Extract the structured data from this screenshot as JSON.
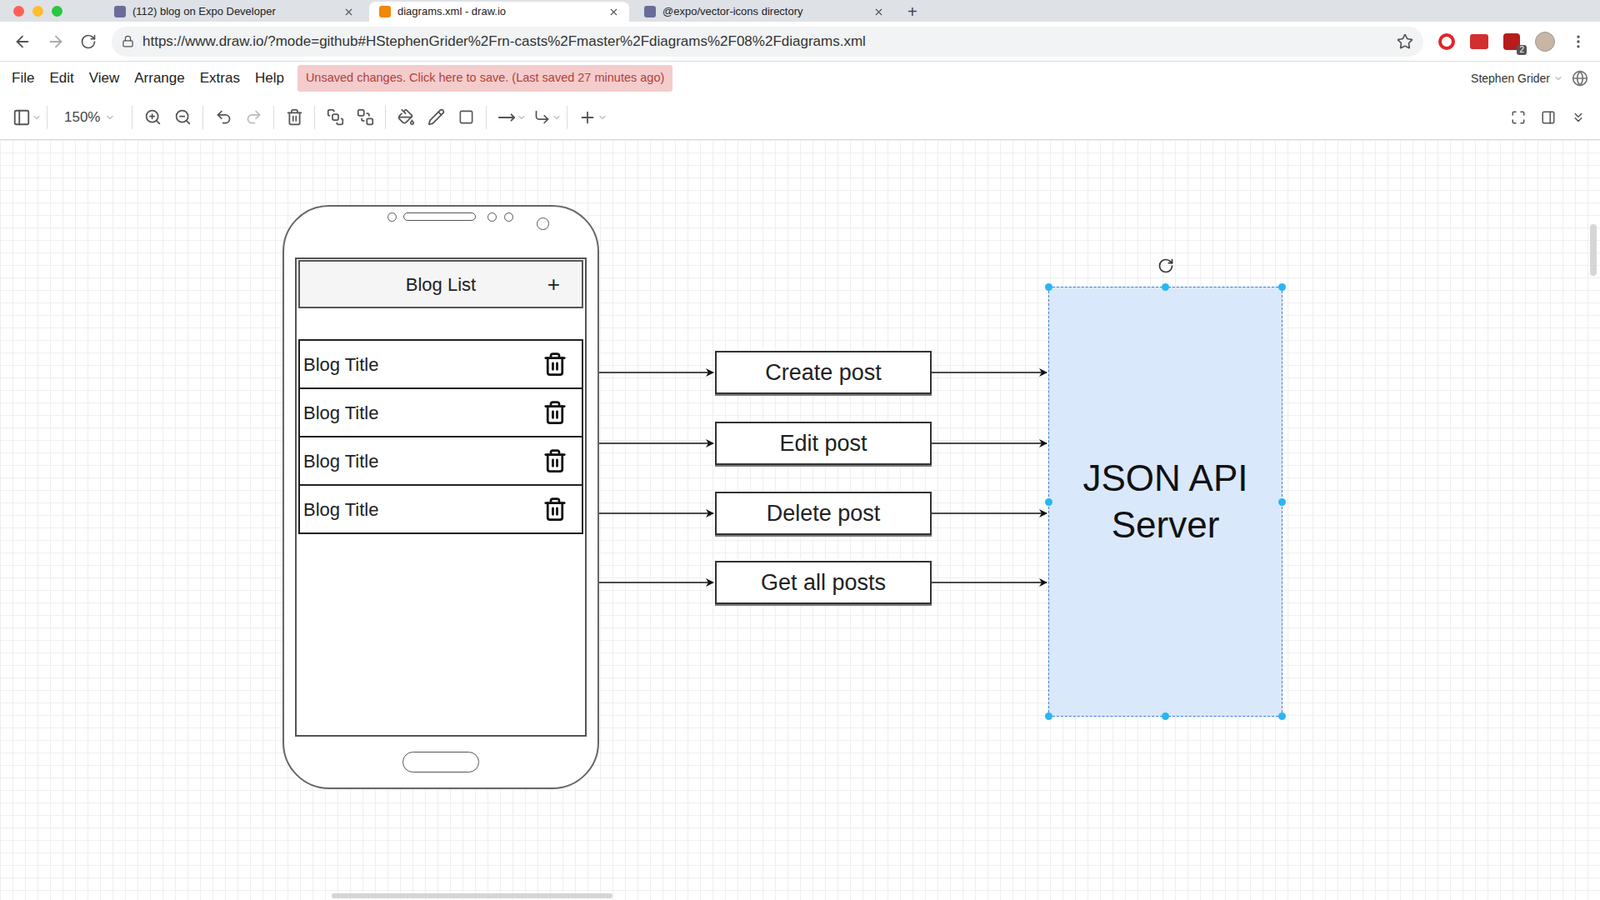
{
  "browser": {
    "tabs": [
      {
        "label": "(112) blog on Expo Developer",
        "selected": false
      },
      {
        "label": "diagrams.xml - draw.io",
        "selected": true
      },
      {
        "label": "@expo/vector-icons directory",
        "selected": false
      }
    ],
    "new_tab": "+",
    "url": "https://www.draw.io/?mode=github#HStephenGrider%2Frn-casts%2Fmaster%2Fdiagrams%2F08%2Fdiagrams.xml",
    "extension_badge": "2"
  },
  "menu": [
    "File",
    "Edit",
    "View",
    "Arrange",
    "Extras",
    "Help"
  ],
  "notice": "Unsaved changes. Click here to save. (Last saved 27 minutes ago)",
  "user": "Stephen Grider",
  "toolbar": {
    "zoom": "150%"
  },
  "diagram": {
    "phone": {
      "header": "Blog List",
      "add": "+",
      "rows": [
        "Blog Title",
        "Blog Title",
        "Blog Title",
        "Blog Title"
      ]
    },
    "actions": [
      {
        "label": "Create post"
      },
      {
        "label": "Edit post"
      },
      {
        "label": "Delete post"
      },
      {
        "label": "Get all posts"
      }
    ],
    "server": {
      "label_lines": [
        "JSON API",
        "Server"
      ],
      "selected": true
    }
  }
}
